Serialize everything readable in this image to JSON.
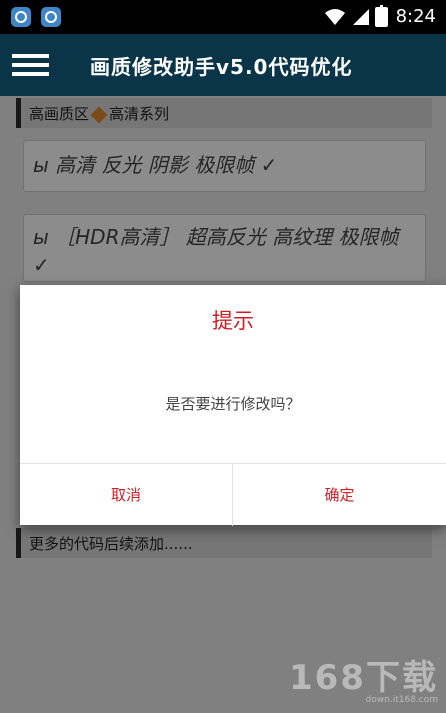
{
  "status_bar": {
    "time": "8:24",
    "icons": [
      "app-icon",
      "app-icon",
      "wifi-icon",
      "signal-icon",
      "battery-icon"
    ]
  },
  "app_bar": {
    "title": "画质修改助手v5.0代码优化",
    "menu_icon": "hamburger-menu-icon"
  },
  "content": {
    "section_head_1": {
      "text_a": "高画质区",
      "text_b": "高清系列",
      "tag_icon": "tag-icon"
    },
    "items": [
      {
        "text": "ы 高清 反光 阴影 极限帧  ✓"
      },
      {
        "text": "ы ［HDR高清］ 超高反光 高纹理 极限帧  ✓"
      }
    ],
    "section_head_2": {
      "text": "更多的代码后续添加......"
    }
  },
  "dialog": {
    "title": "提示",
    "message": "是否要进行修改吗？",
    "cancel": "取消",
    "confirm": "确定"
  },
  "watermark": {
    "big": "168下载",
    "small": "down.it168.com"
  },
  "colors": {
    "app_bar": "#0a3447",
    "accent_red": "#cc1f26",
    "overlay": "rgba(0,0,0,0.45)"
  }
}
